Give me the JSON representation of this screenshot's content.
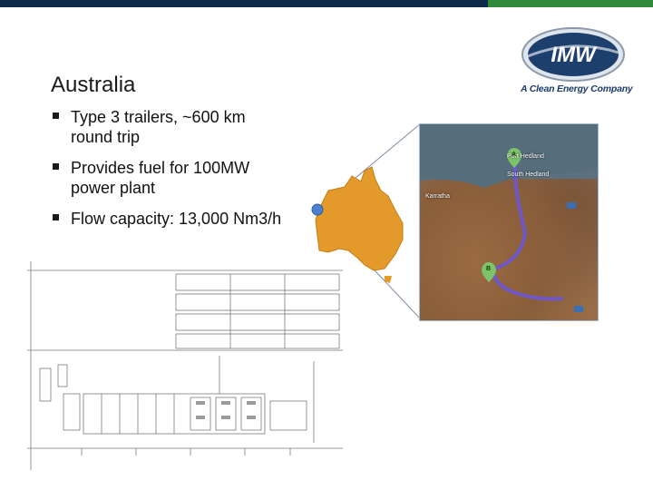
{
  "slide": {
    "title": "Australia",
    "bullets": [
      "Type 3 trailers, ~600 km round trip",
      "Provides fuel for 100MW power plant",
      "Flow capacity: 13,000 Nm3/h"
    ]
  },
  "logo": {
    "wordmark": "IMW",
    "tagline": "A Clean Energy Company"
  },
  "map": {
    "labels": [
      "Port Hedland",
      "South Hedland",
      "Karratha"
    ],
    "markers": [
      "A",
      "B"
    ]
  },
  "colors": {
    "topbar_navy": "#0f2a4a",
    "topbar_green": "#2e8b3a",
    "australia_fill": "#e39a2a",
    "route": "#6a56d8"
  }
}
